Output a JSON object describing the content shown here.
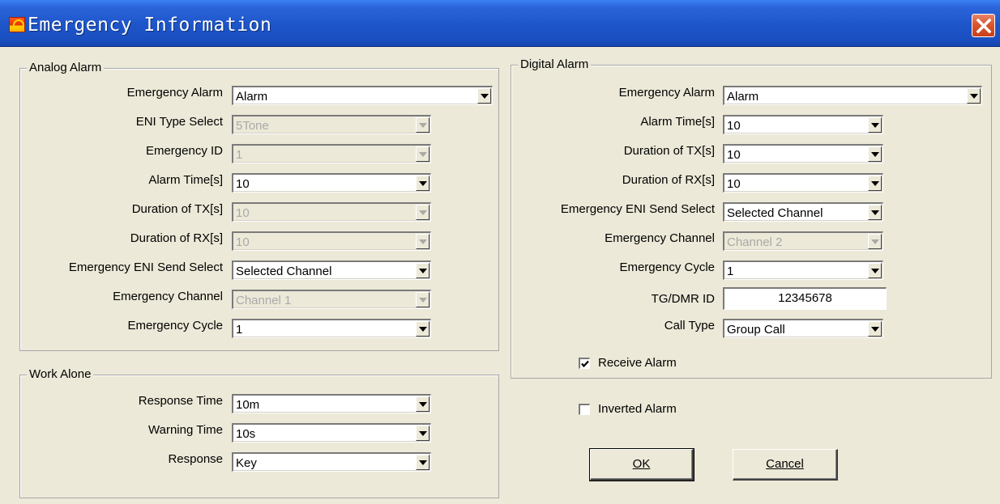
{
  "window": {
    "title": "Emergency Information",
    "close_icon": "close-icon"
  },
  "analog": {
    "group_label": "Analog Alarm",
    "fields": [
      {
        "label": "Emergency Alarm",
        "value": "Alarm",
        "enabled": true
      },
      {
        "label": "ENI Type Select",
        "value": "5Tone",
        "enabled": false
      },
      {
        "label": "Emergency ID",
        "value": "1",
        "enabled": false
      },
      {
        "label": "Alarm Time[s]",
        "value": "10",
        "enabled": true
      },
      {
        "label": "Duration of TX[s]",
        "value": "10",
        "enabled": false
      },
      {
        "label": "Duration of RX[s]",
        "value": "10",
        "enabled": false
      },
      {
        "label": "Emergency ENI Send Select",
        "value": "Selected Channel",
        "enabled": true
      },
      {
        "label": "Emergency Channel",
        "value": "Channel 1",
        "enabled": false
      },
      {
        "label": "Emergency Cycle",
        "value": "1",
        "enabled": true
      }
    ]
  },
  "work_alone": {
    "group_label": "Work Alone",
    "fields": [
      {
        "label": "Response Time",
        "value": "10m",
        "enabled": true
      },
      {
        "label": "Warning Time",
        "value": "10s",
        "enabled": true
      },
      {
        "label": "Response",
        "value": "Key",
        "enabled": true
      }
    ]
  },
  "digital": {
    "group_label": "Digital Alarm",
    "fields": [
      {
        "label": "Emergency Alarm",
        "value": "Alarm",
        "enabled": true
      },
      {
        "label": "Alarm Time[s]",
        "value": "10",
        "enabled": true
      },
      {
        "label": "Duration of TX[s]",
        "value": "10",
        "enabled": true
      },
      {
        "label": "Duration of RX[s]",
        "value": "10",
        "enabled": true
      },
      {
        "label": "Emergency ENI Send Select",
        "value": "Selected Channel",
        "enabled": true
      },
      {
        "label": "Emergency Channel",
        "value": "Channel 2",
        "enabled": false
      },
      {
        "label": "Emergency Cycle",
        "value": "1",
        "enabled": true
      },
      {
        "label": "Call Type",
        "value": "Group Call",
        "enabled": true
      }
    ],
    "tg_dmr": {
      "label": "TG/DMR ID",
      "value": "12345678"
    },
    "receive_alarm": {
      "label": "Receive Alarm",
      "checked": true
    }
  },
  "inverted_alarm": {
    "label": "Inverted Alarm",
    "checked": false
  },
  "buttons": {
    "ok": "OK",
    "cancel": "Cancel"
  },
  "colors": {
    "title_bar": "#1d55c9",
    "dialog_bg": "#ece9d8",
    "close_button": "#d9562f"
  }
}
